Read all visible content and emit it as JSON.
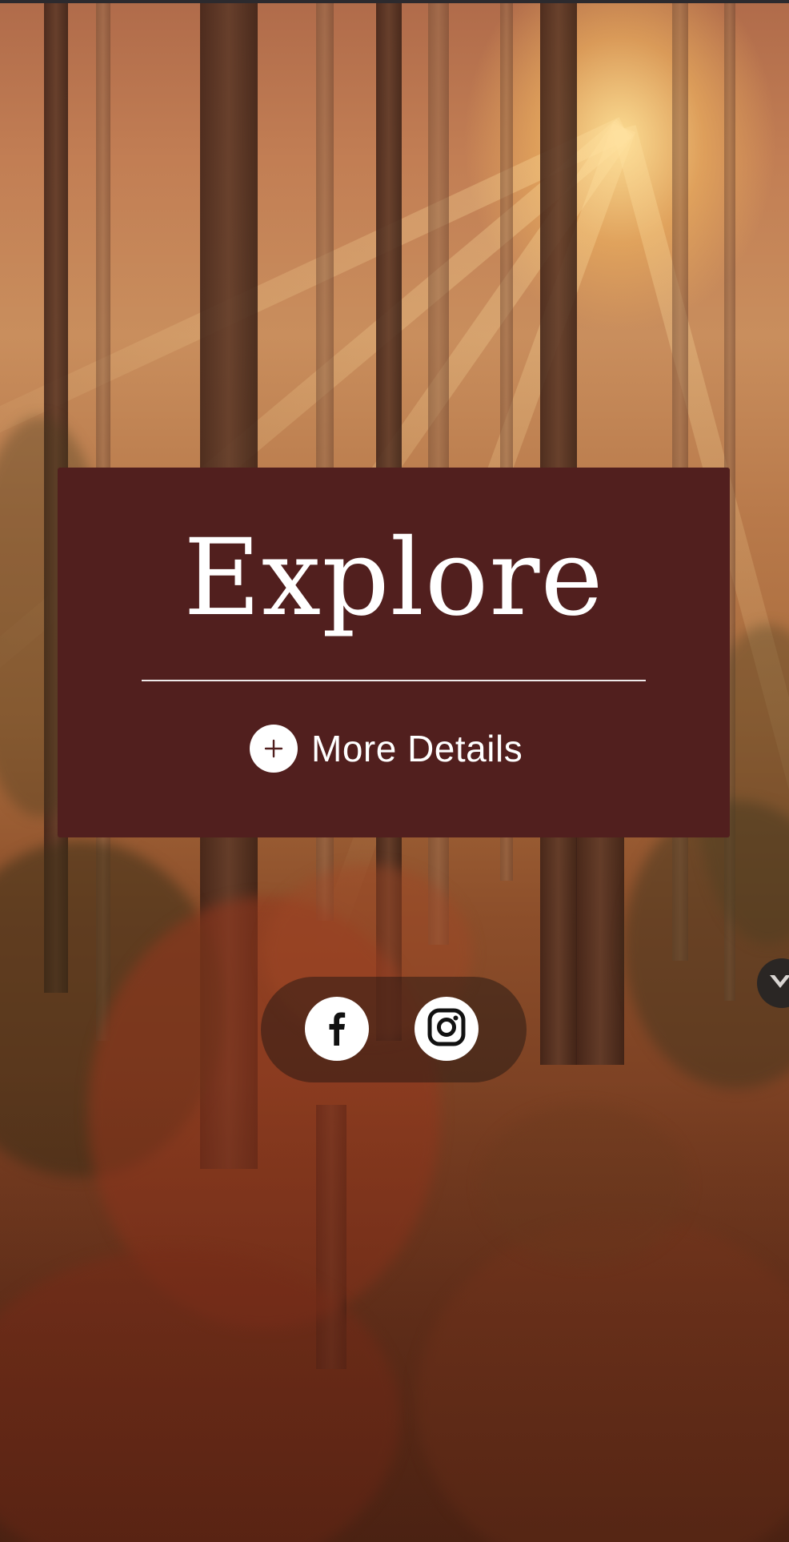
{
  "background": {
    "description_icon": "forest-background-image"
  },
  "card": {
    "title": "Explore",
    "more_details_label": "More Details",
    "color": "#511f1e",
    "icon": "plus-icon"
  },
  "social": {
    "facebook_icon": "facebook-icon",
    "instagram_icon": "instagram-icon"
  },
  "side_button": {
    "icon": "chevron-down-icon"
  }
}
